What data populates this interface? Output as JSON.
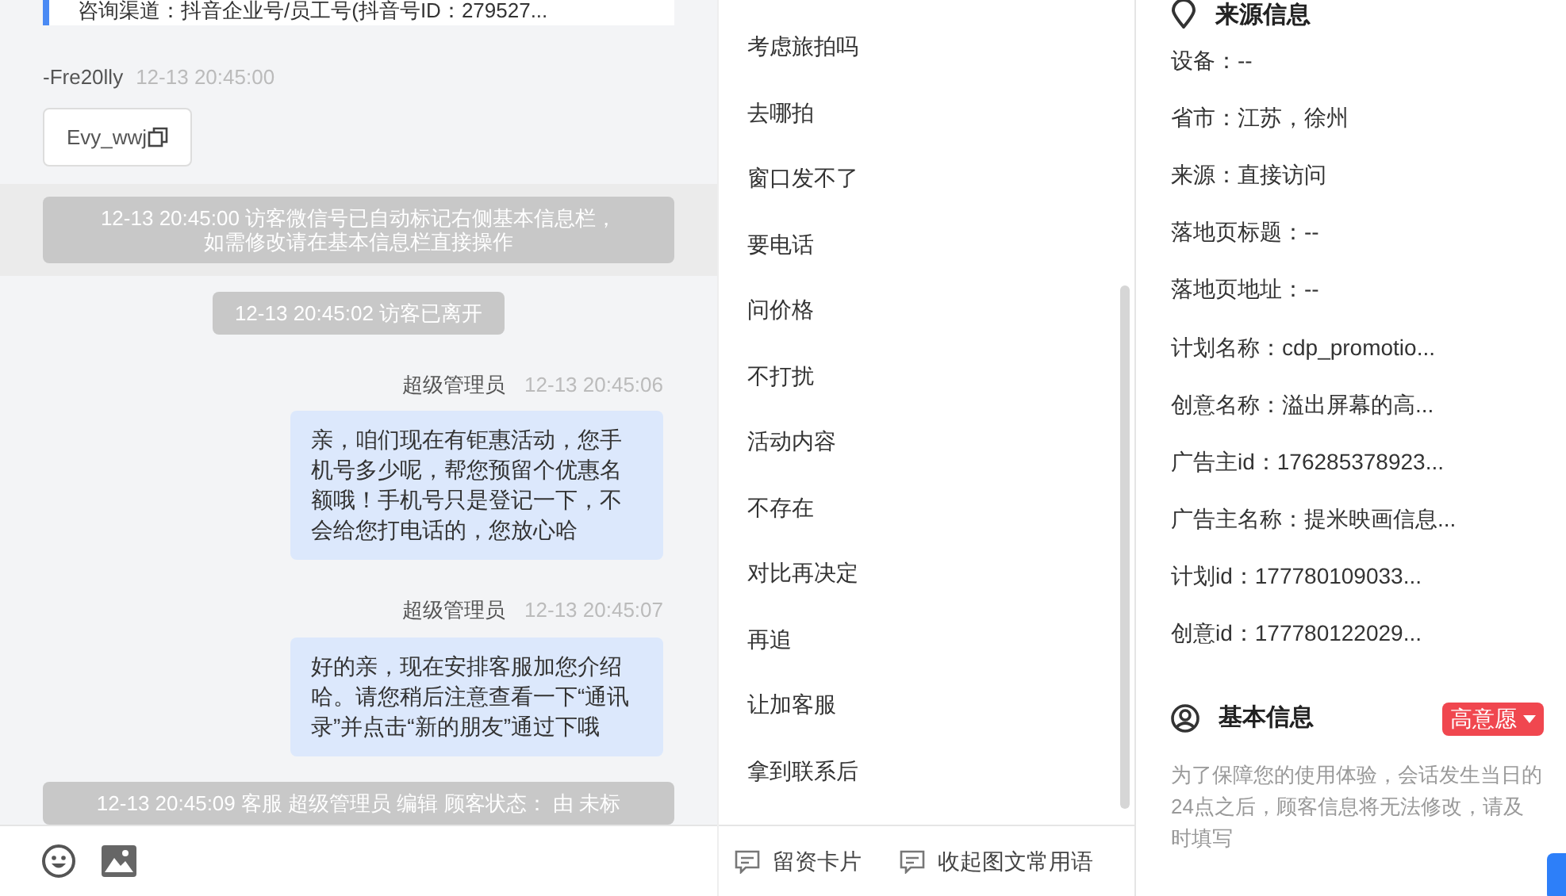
{
  "consult_card": {
    "text": "咨询渠道：抖音企业号/员工号(抖音号ID：279527..."
  },
  "messages": [
    {
      "kind": "visitor",
      "sender": "-Fre20lly",
      "time": "12-13 20:45:00",
      "chip": "Evy_wwj"
    },
    {
      "kind": "notice",
      "lines": [
        "12-13 20:45:00 访客微信号已自动标记右侧基本信息栏，",
        "如需修改请在基本信息栏直接操作"
      ]
    },
    {
      "kind": "event",
      "text": "12-13 20:45:02 访客已离开"
    },
    {
      "kind": "agent",
      "sender": "超级管理员",
      "time": "12-13 20:45:06",
      "text": "亲，咱们现在有钜惠活动，您手机号多少呢，帮您预留个优惠名额哦！手机号只是登记一下，不会给您打电话的，您放心哈"
    },
    {
      "kind": "agent",
      "sender": "超级管理员",
      "time": "12-13 20:45:07",
      "text": "好的亲，现在安排客服加您介绍哈。请您稍后注意查看一下“通讯录”并点击“新的朋友”通过下哦"
    },
    {
      "kind": "event",
      "text": "12-13 20:45:09 客服 超级管理员 编辑 顾客状态： 由 未标"
    }
  ],
  "quick_replies": [
    "考虑旅拍吗",
    "去哪拍",
    "窗口发不了",
    "要电话",
    "问价格",
    "不打扰",
    "活动内容",
    "不存在",
    "对比再决定",
    "再追",
    "让加客服",
    "拿到联系后"
  ],
  "toolbar_actions": [
    "留资卡片",
    "收起图文常用语"
  ],
  "source_info": {
    "title": "来源信息",
    "fields": [
      "设备：--",
      "省市：江苏，徐州",
      "来源：直接访问",
      "落地页标题：--",
      "落地页地址：--",
      "计划名称：cdp_promotio...",
      "创意名称：溢出屏幕的高...",
      "广告主id：176285378923...",
      "广告主名称：提米映画信息...",
      "计划id：177780109033...",
      "创意id：177780122029..."
    ]
  },
  "basic_info": {
    "title": "基本信息",
    "intent_tag": "高意愿",
    "notice": "为了保障您的使用体验，会话发生当日的24点之后，顾客信息将无法修改，请及时填写"
  }
}
